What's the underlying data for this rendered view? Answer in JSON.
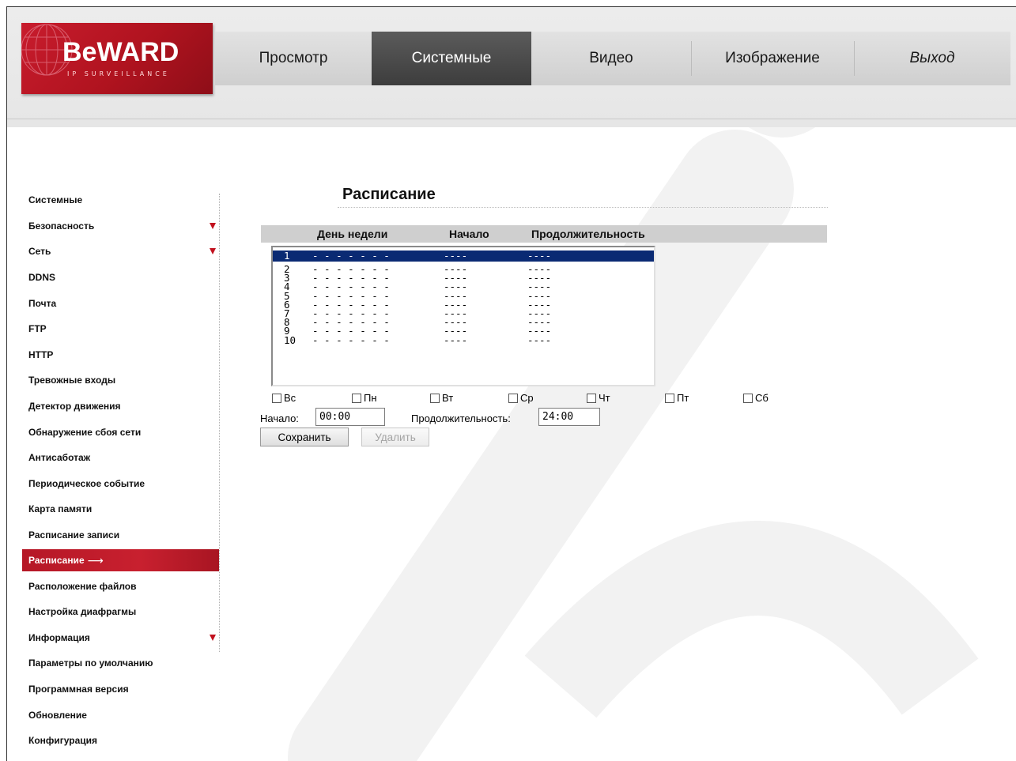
{
  "brand": {
    "name": "BeWARD",
    "tagline": "IP SURVEILLANCE",
    "color": "#c81c2d"
  },
  "topnav": {
    "tabs": [
      {
        "label": "Просмотр",
        "active": false
      },
      {
        "label": "Системные",
        "active": true
      },
      {
        "label": "Видео",
        "active": false
      },
      {
        "label": "Изображение",
        "active": false
      },
      {
        "label": "Выход",
        "active": false
      }
    ]
  },
  "sidebar": {
    "items": [
      {
        "label": "Системные",
        "expandable": false,
        "active": false
      },
      {
        "label": "Безопасность",
        "expandable": true,
        "active": false
      },
      {
        "label": "Сеть",
        "expandable": true,
        "active": false
      },
      {
        "label": "DDNS",
        "expandable": false,
        "active": false
      },
      {
        "label": "Почта",
        "expandable": false,
        "active": false
      },
      {
        "label": "FTP",
        "expandable": false,
        "active": false
      },
      {
        "label": "HTTP",
        "expandable": false,
        "active": false
      },
      {
        "label": "Тревожные входы",
        "expandable": false,
        "active": false
      },
      {
        "label": "Детектор движения",
        "expandable": false,
        "active": false
      },
      {
        "label": "Обнаружение сбоя сети",
        "expandable": false,
        "active": false
      },
      {
        "label": "Антисаботаж",
        "expandable": false,
        "active": false
      },
      {
        "label": "Периодическое событие",
        "expandable": false,
        "active": false
      },
      {
        "label": "Карта памяти",
        "expandable": false,
        "active": false
      },
      {
        "label": "Расписание записи",
        "expandable": false,
        "active": false
      },
      {
        "label": "Расписание",
        "expandable": false,
        "active": true
      },
      {
        "label": "Расположение файлов",
        "expandable": false,
        "active": false
      },
      {
        "label": "Настройка диафрагмы",
        "expandable": false,
        "active": false
      },
      {
        "label": "Информация",
        "expandable": true,
        "active": false
      },
      {
        "label": "Параметры по умолчанию",
        "expandable": false,
        "active": false
      },
      {
        "label": "Программная версия",
        "expandable": false,
        "active": false
      },
      {
        "label": "Обновление",
        "expandable": false,
        "active": false
      },
      {
        "label": "Конфигурация",
        "expandable": false,
        "active": false
      }
    ],
    "active_color": "#c8202f"
  },
  "main": {
    "title": "Расписание",
    "table": {
      "headers": [
        "День недели",
        "Начало",
        "Продолжительность"
      ],
      "rows": [
        {
          "num": "1",
          "days": "- - - - - - -",
          "start": "----",
          "duration": "----",
          "selected": true
        },
        {
          "num": "2",
          "days": "- - - - - - -",
          "start": "----",
          "duration": "----",
          "selected": false
        },
        {
          "num": "3",
          "days": "- - - - - - -",
          "start": "----",
          "duration": "----",
          "selected": false
        },
        {
          "num": "4",
          "days": "- - - - - - -",
          "start": "----",
          "duration": "----",
          "selected": false
        },
        {
          "num": "5",
          "days": "- - - - - - -",
          "start": "----",
          "duration": "----",
          "selected": false
        },
        {
          "num": "6",
          "days": "- - - - - - -",
          "start": "----",
          "duration": "----",
          "selected": false
        },
        {
          "num": "7",
          "days": "- - - - - - -",
          "start": "----",
          "duration": "----",
          "selected": false
        },
        {
          "num": "8",
          "days": "- - - - - - -",
          "start": "----",
          "duration": "----",
          "selected": false
        },
        {
          "num": "9",
          "days": "- - - - - - -",
          "start": "----",
          "duration": "----",
          "selected": false
        },
        {
          "num": "10",
          "days": "- - - - - - -",
          "start": "----",
          "duration": "----",
          "selected": false
        }
      ]
    },
    "days": [
      {
        "label": "Вс",
        "checked": false
      },
      {
        "label": "Пн",
        "checked": false
      },
      {
        "label": "Вт",
        "checked": false
      },
      {
        "label": "Ср",
        "checked": false
      },
      {
        "label": "Чт",
        "checked": false
      },
      {
        "label": "Пт",
        "checked": false
      },
      {
        "label": "Сб",
        "checked": false
      }
    ],
    "start_label": "Начало:",
    "start_value": "00:00",
    "duration_label": "Продолжительность:",
    "duration_value": "24:00",
    "save_label": "Сохранить",
    "delete_label": "Удалить",
    "selection_color": "#0a2a73"
  }
}
